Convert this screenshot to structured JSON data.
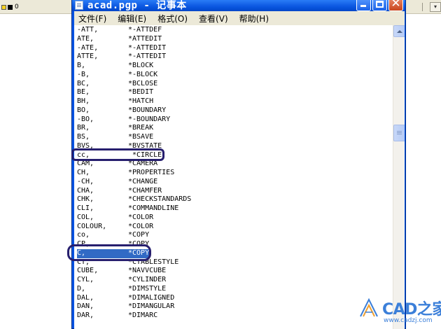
{
  "background_app": {
    "layer_value": "0"
  },
  "window": {
    "title": "acad.pgp - 记事本",
    "menu": [
      "文件(F)",
      "编辑(E)",
      "格式(O)",
      "查看(V)",
      "帮助(H)"
    ]
  },
  "content": {
    "lines": [
      {
        "alias": "-ATT,",
        "command": "*-ATTDEF"
      },
      {
        "alias": "ATE,",
        "command": "*ATTEDIT"
      },
      {
        "alias": "-ATE,",
        "command": "*-ATTEDIT"
      },
      {
        "alias": "ATTE,",
        "command": "*-ATTEDIT"
      },
      {
        "alias": "B,",
        "command": "*BLOCK"
      },
      {
        "alias": "-B,",
        "command": "*-BLOCK"
      },
      {
        "alias": "BC,",
        "command": "*BCLOSE"
      },
      {
        "alias": "BE,",
        "command": "*BEDIT"
      },
      {
        "alias": "BH,",
        "command": "*HATCH"
      },
      {
        "alias": "BO,",
        "command": "*BOUNDARY"
      },
      {
        "alias": "-BO,",
        "command": "*-BOUNDARY"
      },
      {
        "alias": "BR,",
        "command": "*BREAK"
      },
      {
        "alias": "BS,",
        "command": "*BSAVE"
      },
      {
        "alias": "BVS,",
        "command": "*BVSTATE"
      },
      {
        "alias": "cc,",
        "command": " *CIRCLE"
      },
      {
        "alias": "CAM,",
        "command": "*CAMERA"
      },
      {
        "alias": "CH,",
        "command": "*PROPERTIES"
      },
      {
        "alias": "-CH,",
        "command": "*CHANGE"
      },
      {
        "alias": "CHA,",
        "command": "*CHAMFER"
      },
      {
        "alias": "CHK,",
        "command": "*CHECKSTANDARDS"
      },
      {
        "alias": "CLI,",
        "command": "*COMMANDLINE"
      },
      {
        "alias": "COL,",
        "command": "*COLOR"
      },
      {
        "alias": "COLOUR,",
        "command": "*COLOR"
      },
      {
        "alias": "co,",
        "command": "*COPY"
      },
      {
        "alias": "CP,",
        "command": "*COPY"
      },
      {
        "alias": "C,",
        "command": "*COPY"
      },
      {
        "alias": "CT,",
        "command": "*CTABLESTYLE"
      },
      {
        "alias": "CUBE,",
        "command": "*NAVVCUBE"
      },
      {
        "alias": "CYL,",
        "command": "*CYLINDER"
      },
      {
        "alias": "D,",
        "command": "*DIMSTYLE"
      },
      {
        "alias": "DAL,",
        "command": "*DIMALIGNED"
      },
      {
        "alias": "DAN,",
        "command": "*DIMANGULAR"
      },
      {
        "alias": "DAR,",
        "command": "*DIMARC"
      }
    ],
    "selected_line_index": 25
  },
  "watermark": {
    "brand": "CAD之家",
    "url": "www.cadzj.com"
  },
  "colors": {
    "title_bar": "#0a56e0",
    "selection": "#316ac5",
    "highlight_box": "#271f6e",
    "watermark": "#3b7fd9"
  }
}
